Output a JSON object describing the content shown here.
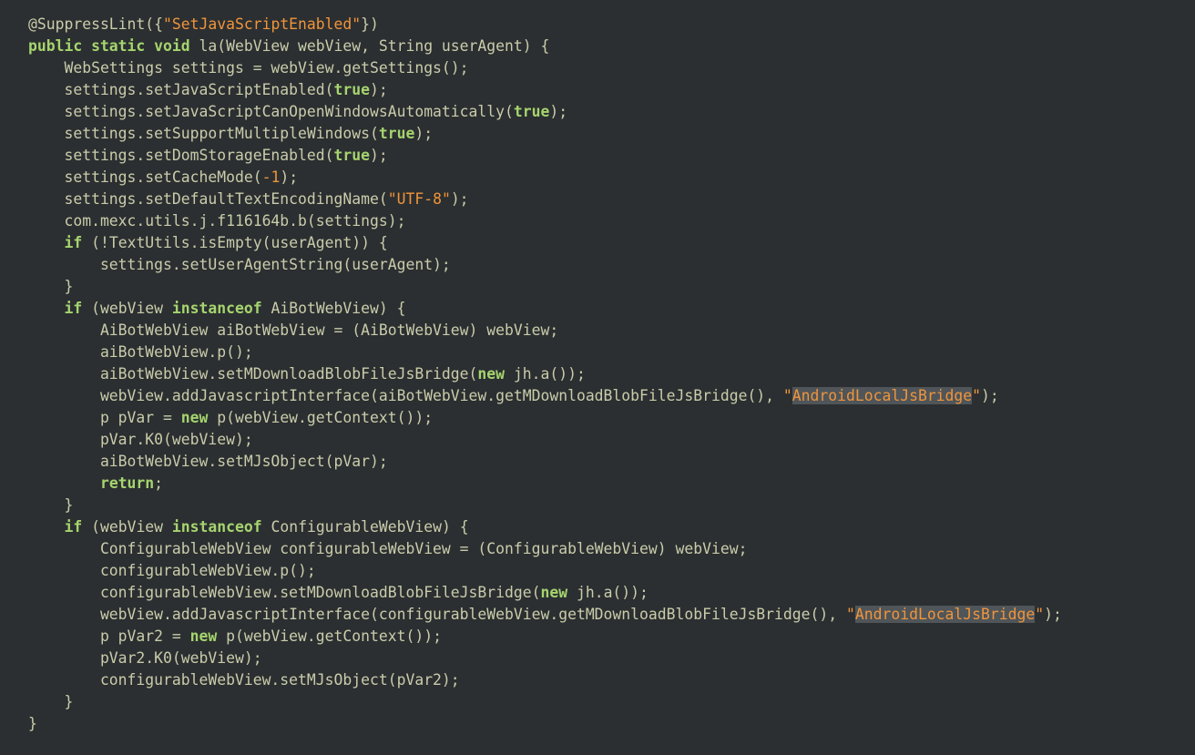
{
  "editor": {
    "lines": [
      [
        [
          "t",
          "@SuppressLint({"
        ],
        [
          "s",
          "\"SetJavaScriptEnabled\""
        ],
        [
          "t",
          "})"
        ]
      ],
      [
        [
          "k",
          "public static void"
        ],
        [
          "t",
          " la(WebView webView, String userAgent) {"
        ]
      ],
      [
        [
          "t",
          "    WebSettings settings = webView.getSettings();"
        ]
      ],
      [
        [
          "t",
          "    settings.setJavaScriptEnabled("
        ],
        [
          "k",
          "true"
        ],
        [
          "t",
          ");"
        ]
      ],
      [
        [
          "t",
          "    settings.setJavaScriptCanOpenWindowsAutomatically("
        ],
        [
          "k",
          "true"
        ],
        [
          "t",
          ");"
        ]
      ],
      [
        [
          "t",
          "    settings.setSupportMultipleWindows("
        ],
        [
          "k",
          "true"
        ],
        [
          "t",
          ");"
        ]
      ],
      [
        [
          "t",
          "    settings.setDomStorageEnabled("
        ],
        [
          "k",
          "true"
        ],
        [
          "t",
          ");"
        ]
      ],
      [
        [
          "t",
          "    settings.setCacheMode("
        ],
        [
          "n",
          "-1"
        ],
        [
          "t",
          ");"
        ]
      ],
      [
        [
          "t",
          "    settings.setDefaultTextEncodingName("
        ],
        [
          "s",
          "\"UTF-8\""
        ],
        [
          "t",
          ");"
        ]
      ],
      [
        [
          "t",
          "    com.mexc.utils.j.f116164b.b(settings);"
        ]
      ],
      [
        [
          "t",
          "    "
        ],
        [
          "k",
          "if"
        ],
        [
          "t",
          " (!TextUtils.isEmpty(userAgent)) {"
        ]
      ],
      [
        [
          "t",
          "        settings.setUserAgentString(userAgent);"
        ]
      ],
      [
        [
          "t",
          "    }"
        ]
      ],
      [
        [
          "t",
          "    "
        ],
        [
          "k",
          "if"
        ],
        [
          "t",
          " (webView "
        ],
        [
          "k",
          "instanceof"
        ],
        [
          "t",
          " AiBotWebView) {"
        ]
      ],
      [
        [
          "t",
          "        AiBotWebView aiBotWebView = (AiBotWebView) webView;"
        ]
      ],
      [
        [
          "t",
          "        aiBotWebView.p();"
        ]
      ],
      [
        [
          "t",
          "        aiBotWebView.setMDownloadBlobFileJsBridge("
        ],
        [
          "k",
          "new"
        ],
        [
          "t",
          " jh.a());"
        ]
      ],
      [
        [
          "t",
          "        webView.addJavascriptInterface(aiBotWebView.getMDownloadBlobFileJsBridge(), "
        ],
        [
          "s",
          "\""
        ],
        [
          "h",
          "AndroidLocalJsBridge"
        ],
        [
          "s",
          "\""
        ],
        [
          "t",
          ");"
        ]
      ],
      [
        [
          "t",
          "        p pVar = "
        ],
        [
          "k",
          "new"
        ],
        [
          "t",
          " p(webView.getContext());"
        ]
      ],
      [
        [
          "t",
          "        pVar.K0(webView);"
        ]
      ],
      [
        [
          "t",
          "        aiBotWebView.setMJsObject(pVar);"
        ]
      ],
      [
        [
          "t",
          "        "
        ],
        [
          "k",
          "return"
        ],
        [
          "t",
          ";"
        ]
      ],
      [
        [
          "t",
          "    }"
        ]
      ],
      [
        [
          "t",
          "    "
        ],
        [
          "k",
          "if"
        ],
        [
          "t",
          " (webView "
        ],
        [
          "k",
          "instanceof"
        ],
        [
          "t",
          " ConfigurableWebView) {"
        ]
      ],
      [
        [
          "t",
          "        ConfigurableWebView configurableWebView = (ConfigurableWebView) webView;"
        ]
      ],
      [
        [
          "t",
          "        configurableWebView.p();"
        ]
      ],
      [
        [
          "t",
          "        configurableWebView.setMDownloadBlobFileJsBridge("
        ],
        [
          "k",
          "new"
        ],
        [
          "t",
          " jh.a());"
        ]
      ],
      [
        [
          "t",
          "        webView.addJavascriptInterface(configurableWebView.getMDownloadBlobFileJsBridge(), "
        ],
        [
          "s",
          "\""
        ],
        [
          "h",
          "AndroidLocalJsBridge"
        ],
        [
          "s",
          "\""
        ],
        [
          "t",
          ");"
        ]
      ],
      [
        [
          "t",
          "        p pVar2 = "
        ],
        [
          "k",
          "new"
        ],
        [
          "t",
          " p(webView.getContext());"
        ]
      ],
      [
        [
          "t",
          "        pVar2.K0(webView);"
        ]
      ],
      [
        [
          "t",
          "        configurableWebView.setMJsObject(pVar2);"
        ]
      ],
      [
        [
          "t",
          "    }"
        ]
      ],
      [
        [
          "t",
          "}"
        ]
      ]
    ]
  },
  "colors": {
    "background": "#2b2f31",
    "plain_text": "#b9c0c5",
    "keyword": "#a6d46e",
    "string": "#f0943b",
    "highlight": "#4f5559"
  }
}
